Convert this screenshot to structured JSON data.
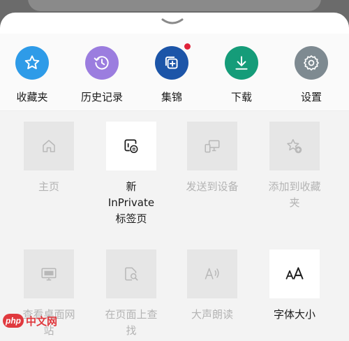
{
  "quick_actions": [
    {
      "label": "收藏夹",
      "icon": "star-icon",
      "color": "#2e9be8"
    },
    {
      "label": "历史记录",
      "icon": "history-icon",
      "color": "#9b7ddf"
    },
    {
      "label": "集锦",
      "icon": "collections-icon",
      "color": "#1c55a8",
      "has_badge": true
    },
    {
      "label": "下载",
      "icon": "download-icon",
      "color": "#159c79"
    },
    {
      "label": "设置",
      "icon": "gear-icon",
      "color": "#7e8a91"
    }
  ],
  "tiles": [
    {
      "label": "主页",
      "icon": "home-icon",
      "enabled": false
    },
    {
      "label": "新\nInPrivate\n标签页",
      "icon": "inprivate-tab-icon",
      "enabled": true
    },
    {
      "label": "发送到设备",
      "icon": "send-to-device-icon",
      "enabled": false
    },
    {
      "label": "添加到收藏\n夹",
      "icon": "add-favorite-icon",
      "enabled": false
    },
    {
      "label": "查看桌面网\n站",
      "icon": "desktop-site-icon",
      "enabled": false
    },
    {
      "label": "在页面上查\n找",
      "icon": "find-in-page-icon",
      "enabled": false
    },
    {
      "label": "大声朗读",
      "icon": "read-aloud-icon",
      "enabled": false
    },
    {
      "label": "字体大小",
      "icon": "font-size-icon",
      "enabled": true
    }
  ],
  "watermark": {
    "brand": "php",
    "text": "中文网"
  }
}
